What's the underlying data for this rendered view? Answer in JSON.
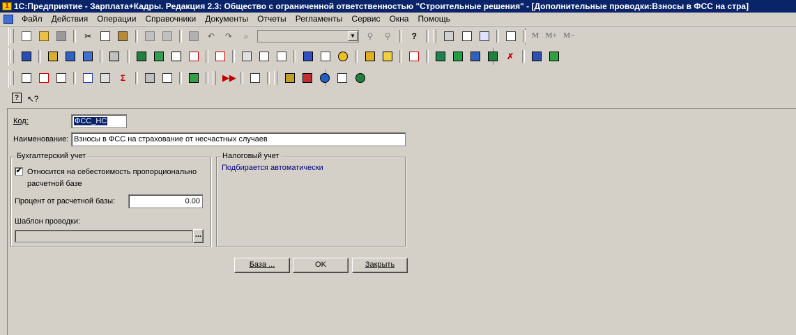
{
  "window": {
    "title": "1С:Предприятие - Зарплата+Кадры. Редакция 2.3: Общество с ограниченной ответственностью \"Строительные решения\" - [Дополнительные проводки:Взносы в ФСС на стра]"
  },
  "menu": {
    "items": [
      "Файл",
      "Действия",
      "Операции",
      "Справочники",
      "Документы",
      "Отчеты",
      "Регламенты",
      "Сервис",
      "Окна",
      "Помощь"
    ]
  },
  "toolbar": {
    "m_labels": [
      "M",
      "M+",
      "M−"
    ]
  },
  "form": {
    "code_label": "Код:",
    "code_value": "ФСС_НС",
    "name_label": "Наименование:",
    "name_value": "Взносы в ФСС на страхование от несчастных случаев",
    "accounting": {
      "legend": "Бухгалтерский учет",
      "checkbox_line1": "Относится на себестоимость пропорционально",
      "checkbox_line2": "расчетной базе",
      "checkbox_checked": "✔",
      "percent_label": "Процент от расчетной базы:",
      "percent_value": "0.00",
      "template_label": "Шаблон проводки:",
      "template_value": "",
      "browse_label": "..."
    },
    "tax": {
      "legend": "Налоговый учет",
      "value": "Подбирается автоматически"
    },
    "buttons": {
      "base": "База ...",
      "ok": "OK",
      "close": "Закрыть"
    }
  },
  "colors": {
    "titlebar": "#0a246a",
    "tax_text": "#00007f"
  }
}
